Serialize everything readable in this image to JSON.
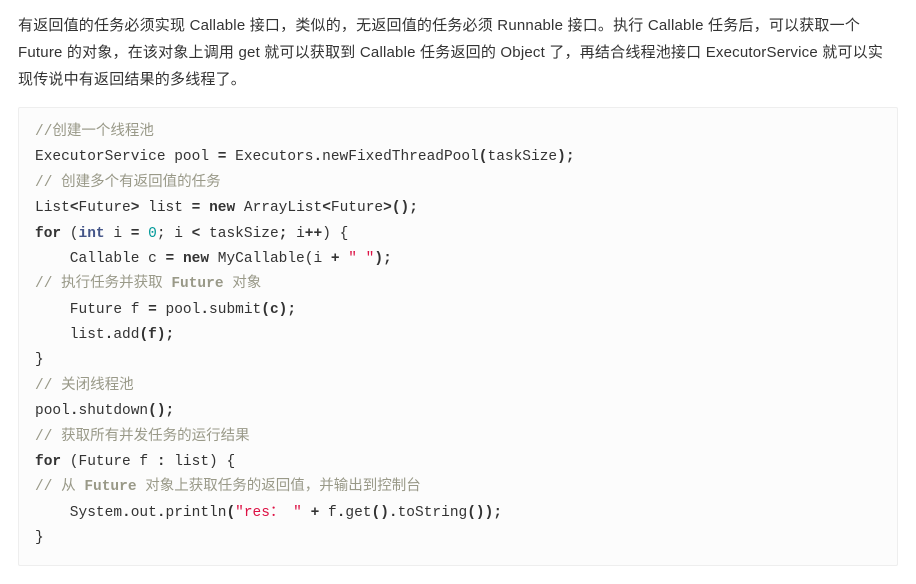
{
  "paragraph": "有返回值的任务必须实现 Callable 接口，类似的，无返回值的任务必须 Runnable 接口。执行 Callable 任务后，可以获取一个 Future 的对象，在该对象上调用 get 就可以获取到 Callable 任务返回的 Object 了，再结合线程池接口 ExecutorService 就可以实现传说中有返回结果的多线程了。",
  "code": {
    "c1": "//创建一个线程池",
    "l2a": "ExecutorService pool ",
    "l2b": "=",
    "l2c": " Executors",
    "l2d": ".",
    "l2e": "newFixedThreadPool",
    "l2f": "(",
    "l2g": "taskSize",
    "l2h": ");",
    "c3": "// 创建多个有返回值的任务",
    "l4a": "List",
    "l4b": "<",
    "l4c": "Future",
    "l4d": ">",
    "l4e": " list ",
    "l4f": "=",
    "l4g": " ",
    "l4h": "new",
    "l4i": " ArrayList",
    "l4j": "<",
    "l4k": "Future",
    "l4l": ">",
    "l4m": "();",
    "l5a": "for",
    "l5b": " (",
    "l5c": "int",
    "l5d": " i ",
    "l5e": "=",
    "l5f": " ",
    "l5g": "0",
    "l5h": "; i ",
    "l5i": "<",
    "l5j": " taskSize",
    "l5k": ";",
    "l5l": " i",
    "l5m": "++",
    "l5n": ") {",
    "l6a": "    Callable c ",
    "l6b": "=",
    "l6c": " ",
    "l6d": "new",
    "l6e": " MyCallable(i ",
    "l6f": "+",
    "l6g": " ",
    "l6h": "\" \"",
    "l6i": ");",
    "c7a": "// 执行任务并获取 ",
    "c7b": "Future",
    "c7c": " 对象",
    "l8a": "    Future f ",
    "l8b": "=",
    "l8c": " pool",
    "l8d": ".",
    "l8e": "submit",
    "l8f": "(c);",
    "l9a": "    list",
    "l9b": ".",
    "l9c": "add",
    "l9d": "(f);",
    "l10": "}",
    "c11": "// 关闭线程池",
    "l12a": "pool",
    "l12b": ".",
    "l12c": "shutdown",
    "l12d": "();",
    "c13": "// 获取所有并发任务的运行结果",
    "l14a": "for",
    "l14b": " (Future f ",
    "l14c": ":",
    "l14d": " list) {",
    "c15a": "// 从 ",
    "c15b": "Future",
    "c15c": " 对象上获取任务的返回值，并输出到控制台",
    "l16a": "    System",
    "l16b": ".",
    "l16c": "out",
    "l16d": ".",
    "l16e": "println",
    "l16f": "(",
    "l16g": "\"res： \"",
    "l16h": " ",
    "l16i": "+",
    "l16j": " f",
    "l16k": ".",
    "l16l": "get",
    "l16m": "()",
    "l16n": ".",
    "l16o": "toString",
    "l16p": "());",
    "l17": "}"
  }
}
